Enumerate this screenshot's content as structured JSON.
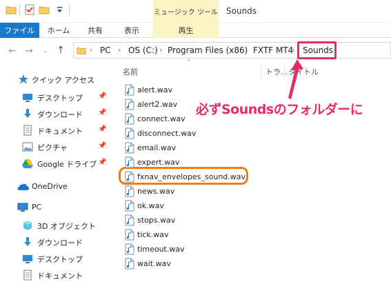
{
  "window": {
    "title": "Sounds",
    "context_tab_header": "ミュージック ツール"
  },
  "ribbon": {
    "tabs": [
      "ファイル",
      "ホーム",
      "共有",
      "表示",
      "再生"
    ]
  },
  "address": {
    "crumbs": [
      "PC",
      "OS (C:)",
      "Program Files (x86)",
      "FXTF MT4",
      "Sounds"
    ]
  },
  "columns": {
    "name": "名前",
    "track": "トラ...",
    "title": "タイトル"
  },
  "nav_pane": {
    "quick_access": "クイック アクセス",
    "quick_items": [
      {
        "label": "デスクトップ",
        "icon": "desktop-icon"
      },
      {
        "label": "ダウンロード",
        "icon": "download-icon"
      },
      {
        "label": "ドキュメント",
        "icon": "documents-icon"
      },
      {
        "label": "ピクチャ",
        "icon": "pictures-icon"
      },
      {
        "label": "Google ドライブ",
        "icon": "google-drive-icon"
      }
    ],
    "onedrive": "OneDrive",
    "pc": "PC",
    "pc_items": [
      {
        "label": "3D オブジェクト",
        "icon": "3d-objects-icon"
      },
      {
        "label": "ダウンロード",
        "icon": "download-icon"
      },
      {
        "label": "デスクトップ",
        "icon": "desktop-icon"
      },
      {
        "label": "ドキュメント",
        "icon": "documents-icon"
      }
    ]
  },
  "files": [
    "alert.wav",
    "alert2.wav",
    "connect.wav",
    "disconnect.wav",
    "email.wav",
    "expert.wav",
    "fxnav_envelopes_sound.wav",
    "news.wav",
    "ok.wav",
    "stops.wav",
    "tick.wav",
    "timeout.wav",
    "wait.wav"
  ],
  "highlighted_file_index": 6,
  "callout": "必ずSoundsのフォルダーに",
  "colors": {
    "accent": "#1979ca",
    "callout": "#e8286f",
    "highlight": "#f07a1c",
    "context_tab": "#fcf3c4"
  }
}
